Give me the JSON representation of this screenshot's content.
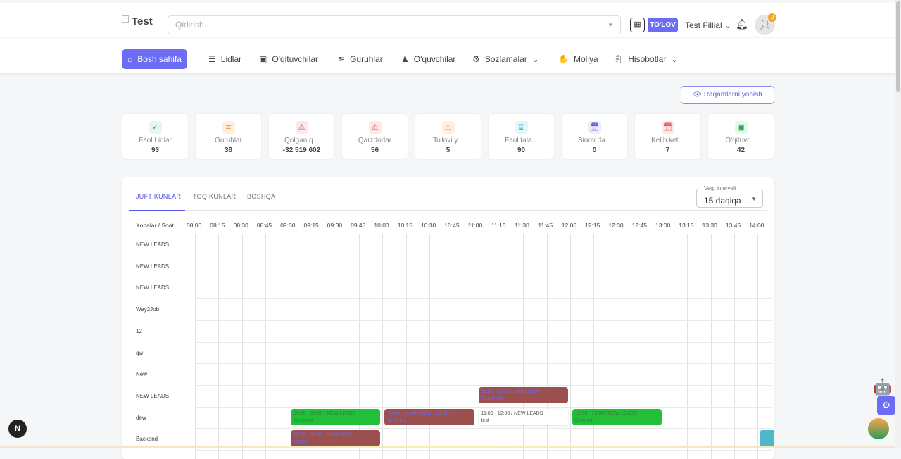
{
  "header": {
    "logo": "Test",
    "search_placeholder": "Qidirish...",
    "pay_label": "TO'LOV",
    "branch": "Test Fillial",
    "notif_count": "0"
  },
  "nav": [
    {
      "label": "Bosh sahifa",
      "icon": "home-icon"
    },
    {
      "label": "Lidlar",
      "icon": "list-icon"
    },
    {
      "label": "O'qituvchilar",
      "icon": "teacher-icon"
    },
    {
      "label": "Guruhlar",
      "icon": "layers-icon"
    },
    {
      "label": "O'quvchilar",
      "icon": "student-icon"
    },
    {
      "label": "Sozlamalar",
      "icon": "gear-icon",
      "dropdown": true
    },
    {
      "label": "Moliya",
      "icon": "finance-icon"
    },
    {
      "label": "Hisobotlar",
      "icon": "report-icon",
      "dropdown": true
    }
  ],
  "hide_numbers_label": "Raqamlarni yopish",
  "stats": [
    {
      "label": "Faol Lidlar",
      "value": "93",
      "color": "#22b14c",
      "bg": "#e6f7ec",
      "icon": "user-check-icon"
    },
    {
      "label": "Guruhlar",
      "value": "38",
      "color": "#f08a24",
      "bg": "#fdf0e2",
      "icon": "layers-icon"
    },
    {
      "label": "Qolgan q...",
      "value": "-32 519 602",
      "color": "#e55353",
      "bg": "#fde8e8",
      "icon": "warning-icon"
    },
    {
      "label": "Qarzdorlar",
      "value": "56",
      "color": "#e55353",
      "bg": "#fde8e8",
      "icon": "warning-icon"
    },
    {
      "label": "To'lovi y...",
      "value": "5",
      "color": "#f0a040",
      "bg": "#fdf0e2",
      "icon": "warning-icon"
    },
    {
      "label": "Faol tala...",
      "value": "90",
      "color": "#35c0d8",
      "bg": "#e3f7fb",
      "icon": "hourglass-icon"
    },
    {
      "label": "Sinov da...",
      "value": "0",
      "color": "#5858e0",
      "bg": "#ececfd",
      "icon": "calendar-icon"
    },
    {
      "label": "Kelib ket...",
      "value": "7",
      "color": "#e55353",
      "bg": "#fde8e8",
      "icon": "calendar-icon"
    },
    {
      "label": "O'qituvc...",
      "value": "42",
      "color": "#22b14c",
      "bg": "#e6f7ec",
      "icon": "teacher-icon"
    }
  ],
  "schedule": {
    "tabs": [
      "JUFT KUNLAR",
      "TOQ KUNLAR",
      "BOSHQA"
    ],
    "interval_label": "Vaqt intervali",
    "interval_value": "15 daqiqa",
    "corner": "Xonalar / Soat",
    "times": [
      "08:00",
      "08:15",
      "08:30",
      "08:45",
      "09:00",
      "09:15",
      "09:30",
      "09:45",
      "10:00",
      "10:15",
      "10:30",
      "10:45",
      "11:00",
      "11:15",
      "11:30",
      "11:45",
      "12:00",
      "12:15",
      "12:30",
      "12:45",
      "13:00",
      "13:15",
      "13:30",
      "13:45",
      "14:00"
    ],
    "rooms": [
      "NEW LEADS",
      "NEW LEADS",
      "NEW LEADS",
      "Way2Job",
      "12",
      "qw",
      "New",
      "NEW LEADS",
      "dew",
      "Backend"
    ],
    "events": [
      {
        "row": 7,
        "start": "11:00",
        "end": "12:00",
        "title": "11:00 - 12:00 / Matematika",
        "sub": "Test 24.03",
        "bg": "#9b4f4f",
        "fg": "#6a6ae8"
      },
      {
        "row": 8,
        "start": "09:00",
        "end": "10:00",
        "title": "09:00 - 10:00 / NEW LEADS",
        "sub": "Gulorom",
        "bg": "#22c03a",
        "fg": "#3a7a3a"
      },
      {
        "row": 8,
        "start": "10:00",
        "end": "11:00",
        "title": "10:00 - 11:00 / NEW LEADS",
        "sub": "Gulorom",
        "bg": "#9b4f4f",
        "fg": "#6a6ae8"
      },
      {
        "row": 8,
        "start": "11:00",
        "end": "12:00",
        "title": "11:00 - 12:00 / NEW LEADS",
        "sub": "test",
        "bg": "#ffffff",
        "fg": "#555555"
      },
      {
        "row": 8,
        "start": "12:00",
        "end": "13:00",
        "title": "12:00 - 13:00 / NEW LEADS",
        "sub": "Gulorom",
        "bg": "#22c03a",
        "fg": "#3a7a3a"
      },
      {
        "row": 9,
        "start": "09:00",
        "end": "10:00",
        "title": "09:00 - 10:00 / NEW LEAD",
        "sub": "otabek",
        "bg": "#9b4f4f",
        "fg": "#6a6ae8"
      },
      {
        "row": 9,
        "start": "14:00",
        "end": "14:15",
        "title": "",
        "sub": "",
        "bg": "#4fb8c8",
        "fg": "#ffffff"
      }
    ]
  }
}
